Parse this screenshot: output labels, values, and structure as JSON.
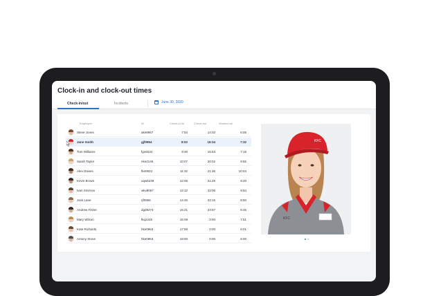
{
  "page": {
    "title": "Clock-in and clock-out times"
  },
  "tabs": [
    {
      "label": "Check-in/out",
      "active": true
    },
    {
      "label": "Incidents",
      "active": false
    }
  ],
  "date_filter": {
    "label": "June 30, 2020",
    "icon": "calendar-icon"
  },
  "table": {
    "columns": [
      "Employee",
      "ID",
      "Check-in tin",
      "Check-out",
      "Worked out"
    ],
    "rows": [
      {
        "name": "Steve Jones",
        "id": "ake8957",
        "check_in": "7:54",
        "check_out": "14:02",
        "worked": "6:06",
        "selected": false
      },
      {
        "name": "Jane Smith",
        "id": "gjf0954",
        "check_in": "8:02",
        "check_out": "15:34",
        "worked": "7:32",
        "selected": true
      },
      {
        "name": "Tom Williams",
        "id": "fgo9234",
        "check_in": "9:46",
        "check_out": "16:53",
        "worked": "7:19",
        "selected": false
      },
      {
        "name": "Sarah Taylor",
        "id": "nke2145",
        "check_in": "10:07",
        "check_out": "20:02",
        "worked": "9:55",
        "selected": false
      },
      {
        "name": "Alex Davies",
        "id": "fke0923",
        "check_in": "11:32",
        "check_out": "21:36",
        "worked": "10:04",
        "selected": false
      },
      {
        "name": "Kevin Brown",
        "id": "uqw5239",
        "check_in": "12:05",
        "check_out": "21:25",
        "worked": "9:20",
        "selected": false
      },
      {
        "name": "Ivan Smirnov",
        "id": "wkv8057",
        "check_in": "13:12",
        "check_out": "23:06",
        "worked": "9:54",
        "selected": false
      },
      {
        "name": "Jack Lane",
        "id": "rjf0956",
        "check_in": "14:45",
        "check_out": "23:15",
        "worked": "8:50",
        "selected": false
      },
      {
        "name": "Andrew Fisher",
        "id": "dgd9274",
        "check_in": "15:21",
        "check_out": "23:57",
        "worked": "8:46",
        "selected": false
      },
      {
        "name": "Mary Wilson",
        "id": "fkq2245",
        "check_in": "16:09",
        "check_out": "0:00",
        "worked": "7:51",
        "selected": false
      },
      {
        "name": "Kate Richards",
        "id": "hke0963",
        "check_in": "17:59",
        "check_out": "0:00",
        "worked": "6:01",
        "selected": false
      },
      {
        "name": "Antony Stone",
        "id": "hke0963",
        "check_in": "18:00",
        "check_out": "0:00",
        "worked": "6:00",
        "selected": false
      }
    ]
  },
  "photo": {
    "caption": "",
    "carousel_count": 2,
    "carousel_active": 0
  },
  "colors": {
    "accent": "#2f6fc4",
    "uniform_red": "#d8232a",
    "shirt_grey": "#8c8f94"
  }
}
